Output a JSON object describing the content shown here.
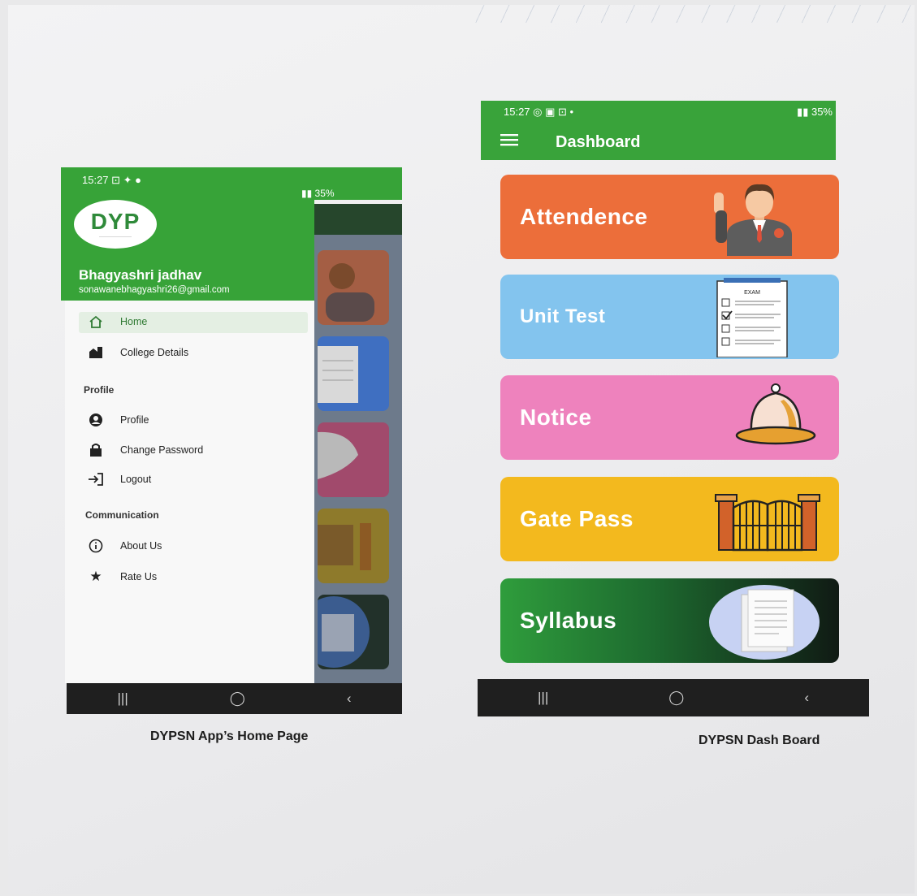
{
  "left_screen": {
    "status": {
      "time": "15:27",
      "right": "35%"
    },
    "logo_text": "DYP",
    "user": {
      "name": "Bhagyashri jadhav",
      "email": "sonawanebhagyashri26@gmail.com"
    },
    "menu": {
      "home": "Home",
      "college_details": "College Details",
      "profile_section": "Profile",
      "profile": "Profile",
      "change_password": "Change Password",
      "logout": "Logout",
      "communication_section": "Communication",
      "about_us": "About Us",
      "rate_us": "Rate Us"
    },
    "caption": "DYPSN App’s  Home Page"
  },
  "right_screen": {
    "status": {
      "time": "15:27",
      "right": "35%"
    },
    "title": "Dashboard",
    "tiles": [
      {
        "label": "Attendence",
        "color": "#ec6e3a"
      },
      {
        "label": "Unit Test",
        "color": "#83c4ee"
      },
      {
        "label": "Notice",
        "color": "#ee82bd"
      },
      {
        "label": "Gate Pass",
        "color": "#f3b91e"
      },
      {
        "label": "Syllabus",
        "color": "#2e9b3c"
      }
    ],
    "exam_label": "EXAM",
    "caption": "DYPSN Dash Board"
  },
  "colors": {
    "green": "#39a33a",
    "navbar": "#1f1f1f"
  }
}
